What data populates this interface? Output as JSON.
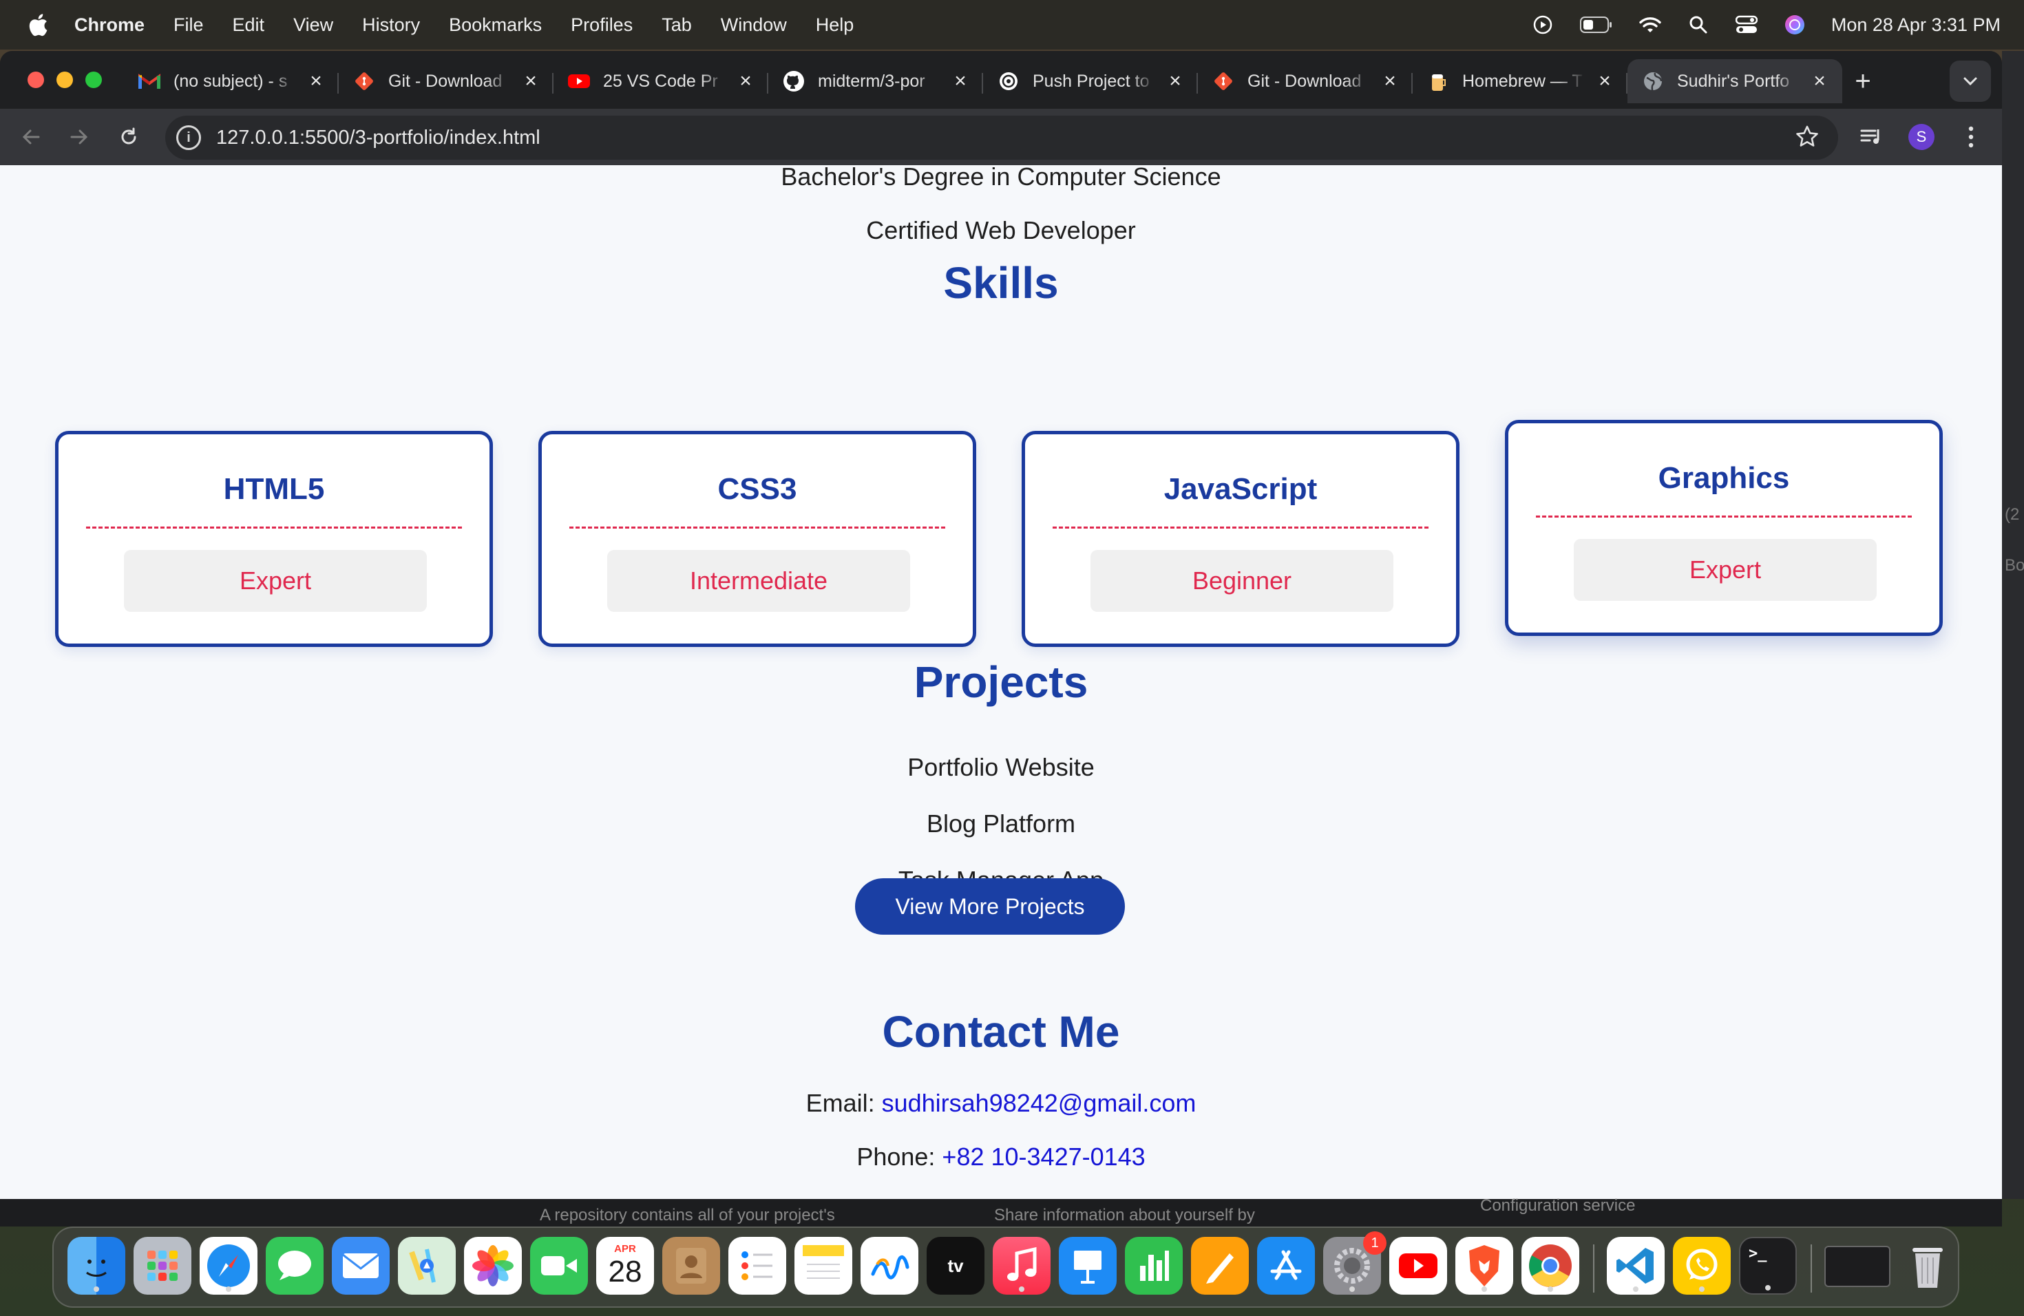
{
  "menubar": {
    "app_name": "Chrome",
    "items": [
      "File",
      "Edit",
      "View",
      "History",
      "Bookmarks",
      "Profiles",
      "Tab",
      "Window",
      "Help"
    ],
    "clock": "Mon 28 Apr  3:31 PM"
  },
  "tabs": [
    {
      "title": "(no subject) - s",
      "icon": "gmail-icon"
    },
    {
      "title": "Git - Download",
      "icon": "git-icon"
    },
    {
      "title": "25 VS Code Pr",
      "icon": "youtube-icon"
    },
    {
      "title": "midterm/3-por",
      "icon": "github-icon"
    },
    {
      "title": "Push Project to",
      "icon": "openai-icon"
    },
    {
      "title": "Git - Download",
      "icon": "git-icon"
    },
    {
      "title": "Homebrew — T",
      "icon": "homebrew-icon"
    },
    {
      "title": "Sudhir's Portfo",
      "icon": "globe-icon",
      "active": true
    }
  ],
  "address_bar": {
    "url": "127.0.0.1:5500/3-portfolio/index.html"
  },
  "profile_initial": "S",
  "page": {
    "education": [
      "Bachelor's Degree in Computer Science",
      "Certified Web Developer"
    ],
    "skills_title": "Skills",
    "skills": [
      {
        "name": "HTML5",
        "level": "Expert"
      },
      {
        "name": "CSS3",
        "level": "Intermediate"
      },
      {
        "name": "JavaScript",
        "level": "Beginner"
      },
      {
        "name": "Graphics",
        "level": "Expert"
      }
    ],
    "projects_title": "Projects",
    "projects": [
      "Portfolio Website",
      "Blog Platform",
      "Task Manager App"
    ],
    "more_button": "View More Projects",
    "contact_title": "Contact Me",
    "contact": {
      "email_label": "Email: ",
      "email": "sudhirsah98242@gmail.com",
      "phone_label": "Phone: ",
      "phone": "+82 10-3427-0143"
    }
  },
  "background_text": {
    "left": "A repository contains all of your project's",
    "middle": "Share information about yourself by",
    "right": "Configuration service",
    "side_top": "(2",
    "side_bottom": "Bo"
  },
  "dock": {
    "calendar_month": "APR",
    "calendar_day": "28",
    "settings_badge": "1",
    "apps": [
      "finder-icon",
      "launchpad-icon",
      "safari-icon",
      "messages-icon",
      "mail-icon",
      "maps-icon",
      "photos-icon",
      "facetime-icon",
      "calendar-icon",
      "contacts-icon",
      "reminders-icon",
      "notes-icon",
      "freeform-icon",
      "appletv-icon",
      "music-icon",
      "keynote-icon",
      "numbers-icon",
      "pages-icon",
      "appstore-icon",
      "system-settings-icon",
      "youtube-app-icon",
      "brave-icon",
      "chrome-icon",
      "vscode-icon",
      "whatsapp-icon",
      "terminal-icon",
      "screen-window-icon",
      "trash-icon"
    ]
  },
  "colors": {
    "accent_blue": "#1a3fa4",
    "accent_red": "#e0284e",
    "link_blue": "#1515d6"
  }
}
